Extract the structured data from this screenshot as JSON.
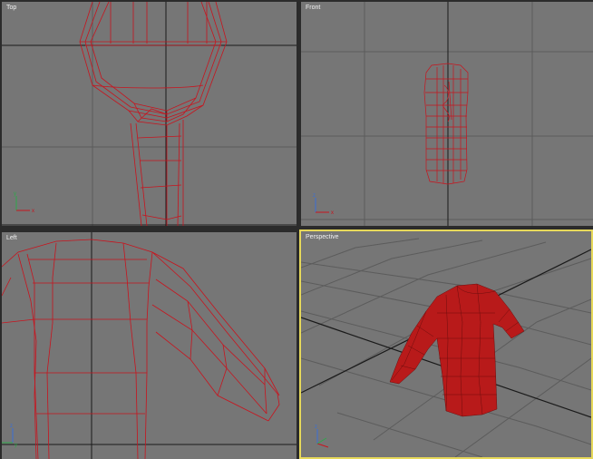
{
  "viewports": {
    "top": {
      "label": "Top",
      "active": false
    },
    "front": {
      "label": "Front",
      "active": false
    },
    "left": {
      "label": "Left",
      "active": false
    },
    "perspective": {
      "label": "Perspective",
      "active": true
    }
  },
  "axis_labels": {
    "x": "x",
    "y": "y",
    "z": "z"
  },
  "colors": {
    "viewport_bg": "#767676",
    "grid": "#5c5c5c",
    "grid_major": "#1a1a1a",
    "wireframe": "#c8141e",
    "mesh_fill": "#b81a1a",
    "active_border": "#e6d85a",
    "label": "#f2f2f2"
  }
}
